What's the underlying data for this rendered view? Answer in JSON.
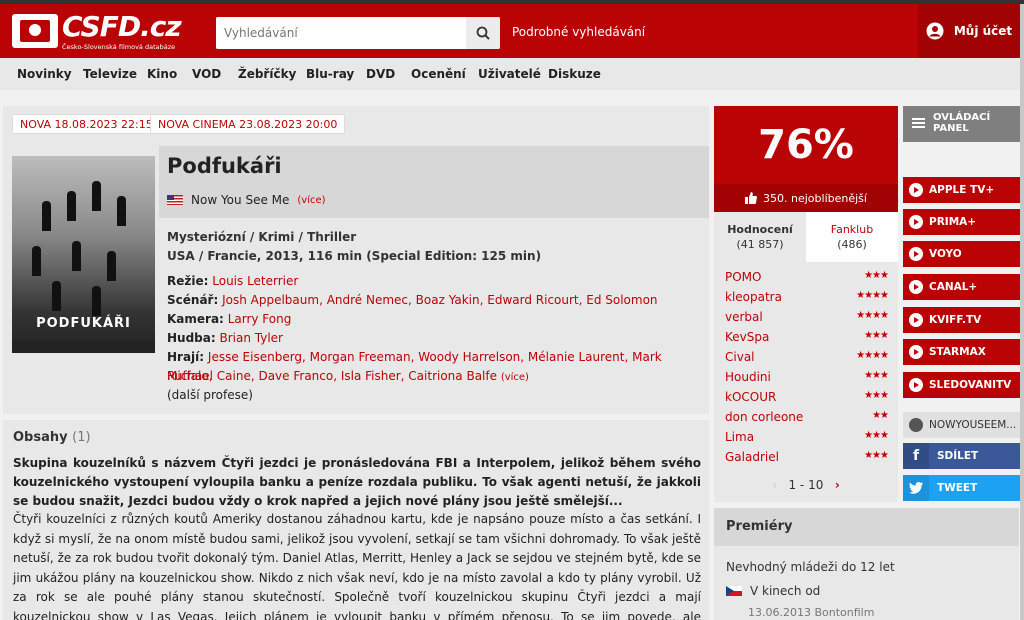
{
  "header": {
    "logo_text": "CSFD.cz",
    "logo_sub": "Česko-Slovenská filmová databáze",
    "search_placeholder": "Vyhledávání",
    "advanced_search": "Podrobné vyhledávání",
    "account": "Můj účet"
  },
  "nav": [
    "Novinky",
    "Televize",
    "Kino",
    "VOD",
    "Žebříčky",
    "Blu-ray",
    "DVD",
    "Ocenění",
    "Uživatelé",
    "Diskuze"
  ],
  "film": {
    "premiere_tags": [
      "NOVA 18.08.2023 22:15",
      "NOVA CINEMA 23.08.2023 20:00"
    ],
    "title": "Podfukáři",
    "poster_title": "PODFUKÁŘI",
    "alt_title": "Now You See Me",
    "more": "(více)",
    "genres": "Mysteriózní / Krimi / Thriller",
    "origin": "USA / Francie, 2013, 116 min (Special Edition: 125 min)",
    "director_label": "Režie:",
    "director": "Louis Leterrier",
    "writers_label": "Scénář:",
    "writers": "Josh Appelbaum, André Nemec, Boaz Yakin, Edward Ricourt, Ed Solomon",
    "camera_label": "Kamera:",
    "camera": "Larry Fong",
    "music_label": "Hudba:",
    "music": "Brian Tyler",
    "cast_label": "Hrají:",
    "cast_line1": "Jesse Eisenberg, Morgan Freeman, Woody Harrelson, Mélanie Laurent, Mark Ruffalo,",
    "cast_line2": "Michael Caine, Dave Franco, Isla Fisher, Caitriona Balfe",
    "cast_more": "(více)",
    "more_professions": "(další profese)"
  },
  "plot": {
    "heading": "Obsahy",
    "count": "(1)",
    "bold_text": "Skupina kouzelníků s názvem Čtyři jezdci je pronásledována FBI a Interpolem, jelikož během svého kouzelnického vystoupení vyloupila banku a peníze rozdala publiku. To však agenti netuší, že jakkoli se budou snažit, Jezdci budou vždy o krok napřed a jejich nové plány jsou ještě smělejší...",
    "text": "Čtyři kouzelníci z různých koutů Ameriky dostanou záhadnou kartu, kde je napsáno pouze místo a čas setkání. I když si myslí, že na onom místě budou sami, jelikož jsou vyvolení, setkají se tam všichni dohromady. To však ještě netuší, že za rok budou tvořit dokonalý tým. Daniel Atlas, Merritt, Henley a Jack se sejdou ve stejném bytě, kde se jim ukážou plány na kouzelnickou show. Nikdo z nich však neví, kdo je na místo zavolal a kdo ty plány vyrobil. Už za rok se ale pouhé plány stanou skutečností. Společně tvoří kouzelnickou skupinu Čtyři jezdci a mají kouzelnickou show v Las Vegas. Jejich plánem je vyloupit banku v přímém přenosu. To se jim povede, ale následně je za to zatkne policie,"
  },
  "rating": {
    "percent": "76%",
    "rank": "350. nejoblíbenější",
    "tab_ratings": "Hodnocení",
    "tab_ratings_count": "(41 857)",
    "tab_fanclub": "Fanklub",
    "tab_fanclub_count": "(486)",
    "users": [
      {
        "name": "POMO",
        "stars": "★★★"
      },
      {
        "name": "kleopatra",
        "stars": "★★★★"
      },
      {
        "name": "verbal",
        "stars": "★★★★"
      },
      {
        "name": "KevSpa",
        "stars": "★★★"
      },
      {
        "name": "Cival",
        "stars": "★★★★"
      },
      {
        "name": "Houdini",
        "stars": "★★★"
      },
      {
        "name": "kOCOUR",
        "stars": "★★★"
      },
      {
        "name": "don corleone",
        "stars": "★★"
      },
      {
        "name": "Lima",
        "stars": "★★★"
      },
      {
        "name": "Galadriel",
        "stars": "★★★"
      }
    ],
    "pager": "1 - 10",
    "pager_prev": "‹",
    "pager_next": "›"
  },
  "premieres": {
    "heading": "Premiéry",
    "age": "Nevhodný mládeži do 12 let",
    "cinema": "V kinech od",
    "cinema_date": "13.06.2013 Bontonfilm"
  },
  "side": {
    "panel_line1": "OVLÁDACÍ",
    "panel_line2": "PANEL",
    "vod": [
      "APPLE TV+",
      "PRIMA+",
      "VOYO",
      "CANAL+",
      "KVIFF.TV",
      "STARMAX",
      "SLEDOVANITV"
    ],
    "website": "NOWYOUSEEM...",
    "facebook_letter": "f",
    "share": "SDÍLET",
    "tweet": "TWEET"
  },
  "colors": {
    "brand": "#ba0305",
    "facebook": "#3b5998",
    "twitter": "#1da1f2"
  }
}
